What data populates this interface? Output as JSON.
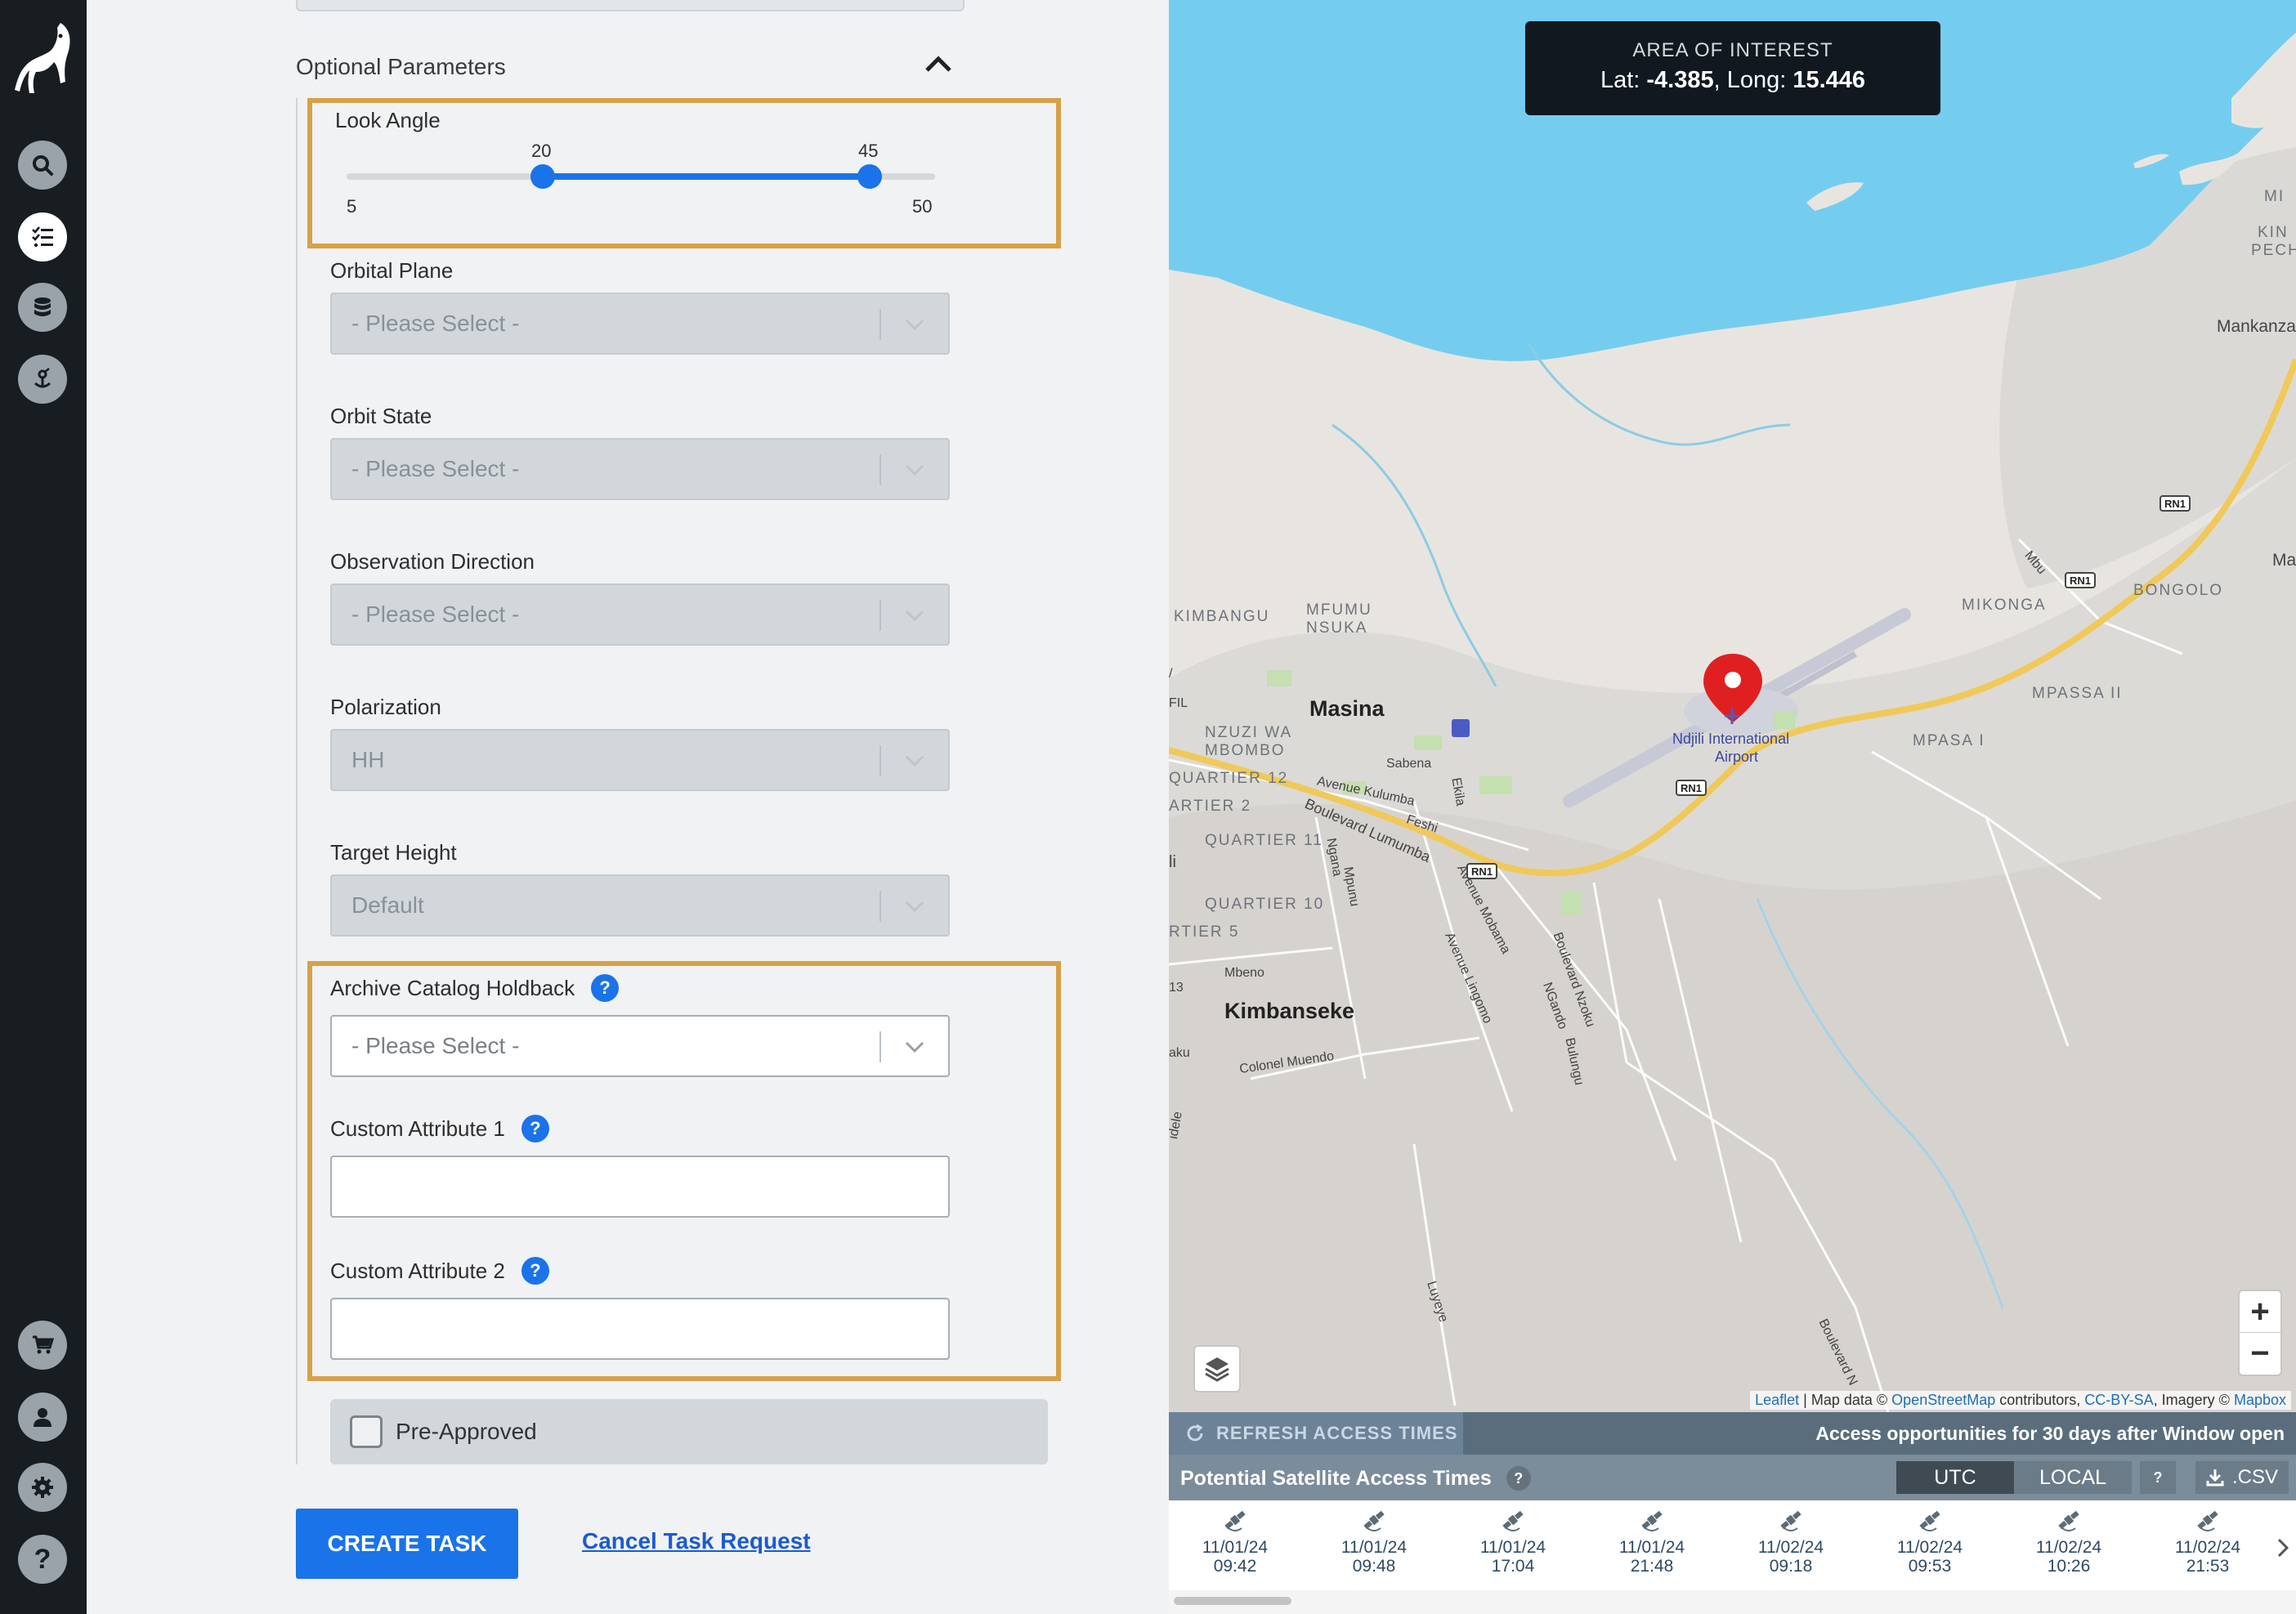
{
  "form": {
    "section_title": "Optional Parameters",
    "look_angle": {
      "label": "Look Angle",
      "min": "5",
      "max": "50",
      "low": "20",
      "high": "45",
      "low_value": 20,
      "high_value": 45,
      "range": [
        5,
        50
      ]
    },
    "orbital_plane": {
      "label": "Orbital Plane",
      "value": "- Please Select -"
    },
    "orbit_state": {
      "label": "Orbit State",
      "value": "- Please Select -"
    },
    "observation_direction": {
      "label": "Observation Direction",
      "value": "- Please Select -"
    },
    "polarization": {
      "label": "Polarization",
      "value": "HH"
    },
    "target_height": {
      "label": "Target Height",
      "value": "Default"
    },
    "archive_holdback": {
      "label": "Archive Catalog Holdback",
      "value": "- Please Select -"
    },
    "custom_attribute_1": {
      "label": "Custom Attribute 1",
      "value": ""
    },
    "custom_attribute_2": {
      "label": "Custom Attribute 2",
      "value": ""
    },
    "pre_approved": {
      "label": "Pre-Approved",
      "checked": false
    },
    "help_glyph": "?",
    "create_label": "CREATE TASK",
    "cancel_label": "Cancel Task Request"
  },
  "nav": {
    "icons": [
      "logo-icon",
      "search-icon",
      "task-list-icon",
      "database-icon",
      "satellite-icon",
      "cart-icon",
      "user-icon",
      "settings-icon",
      "help-icon"
    ],
    "help_glyph": "?",
    "active": "task-list-icon"
  },
  "map": {
    "aoi_title": "AREA OF INTEREST",
    "lat_label": "Lat: ",
    "lat": "-4.385",
    "long_label": ", Long: ",
    "long": "15.446",
    "places": {
      "masina": "Masina",
      "kimbanseke": "Kimbanseke",
      "kimbangu": "KIMBANGU",
      "mfumu": "MFUMU",
      "nsuka": "NSUKA",
      "nzuzi": "NZUZI WA",
      "mbombo": "MBOMBO",
      "quartier12": "QUARTIER 12",
      "quartier2": "ARTIER 2",
      "quartier11": "QUARTIER 11",
      "quartier10": "QUARTIER 10",
      "quartier5": "RTIER 5",
      "mikonga": "MIKONGA",
      "bongolo": "BONGOLO",
      "mpassa2": "MPASSA II",
      "mpasa1": "MPASA I",
      "mankanza": "Mankanza",
      "kin": "KIN",
      "pech": "PECH",
      "mi": "MI",
      "ma": "Ma",
      "airport1": "Ndjili International",
      "airport2": "Airport",
      "sabena": "Sabena",
      "ekila": "Ekila",
      "feshi": "Feshi",
      "kulumba": "Avenue Kulumba",
      "lumumba": "Boulevard Lumumba",
      "ngana": "Ngana",
      "mpunu": "Mpunu",
      "mobama": "Avenue Mobama",
      "lingomo": "Avenue Lingomo",
      "nzoku": "Boulevard Nzoku",
      "ngando": "NGando",
      "bulungu": "Bulungu",
      "mbeno": "Mbeno",
      "muendo": "Colonel Muendo",
      "luyeye": "Luyeye",
      "bvd_n": "Boulevard N",
      "mbu": "Mbu",
      "fil": "FIL",
      "li": "li",
      "n13": "13",
      "aku": "aku",
      "idele": "idele",
      "slash": "/",
      "rn1": "RN1"
    },
    "zoom_in": "+",
    "zoom_out": "−",
    "attribution": {
      "leaflet": "Leaflet",
      "sep": " | Map data © ",
      "osm": "OpenStreetMap",
      "mid": " contributors, ",
      "ccbysa": "CC-BY-SA",
      "img": ", Imagery © ",
      "mapbox": "Mapbox"
    }
  },
  "access": {
    "refresh_label": "REFRESH ACCESS TIMES",
    "note": "Access opportunities for 30 days after Window open",
    "title": "Potential Satellite Access Times",
    "help_glyph": "?",
    "utc": "UTC",
    "local": "LOCAL",
    "csv": ".CSV",
    "slots": [
      {
        "date": "11/01/24",
        "time": "09:42"
      },
      {
        "date": "11/01/24",
        "time": "09:48"
      },
      {
        "date": "11/01/24",
        "time": "17:04"
      },
      {
        "date": "11/01/24",
        "time": "21:48"
      },
      {
        "date": "11/02/24",
        "time": "09:18"
      },
      {
        "date": "11/02/24",
        "time": "09:53"
      },
      {
        "date": "11/02/24",
        "time": "10:26"
      },
      {
        "date": "11/02/24",
        "time": "21:53"
      }
    ]
  },
  "colors": {
    "accent": "#1a73e8",
    "highlight": "#d6a149",
    "rail": "#181d21",
    "water": "#74cdef",
    "road": "#f0c95a",
    "pin": "#e02020"
  }
}
